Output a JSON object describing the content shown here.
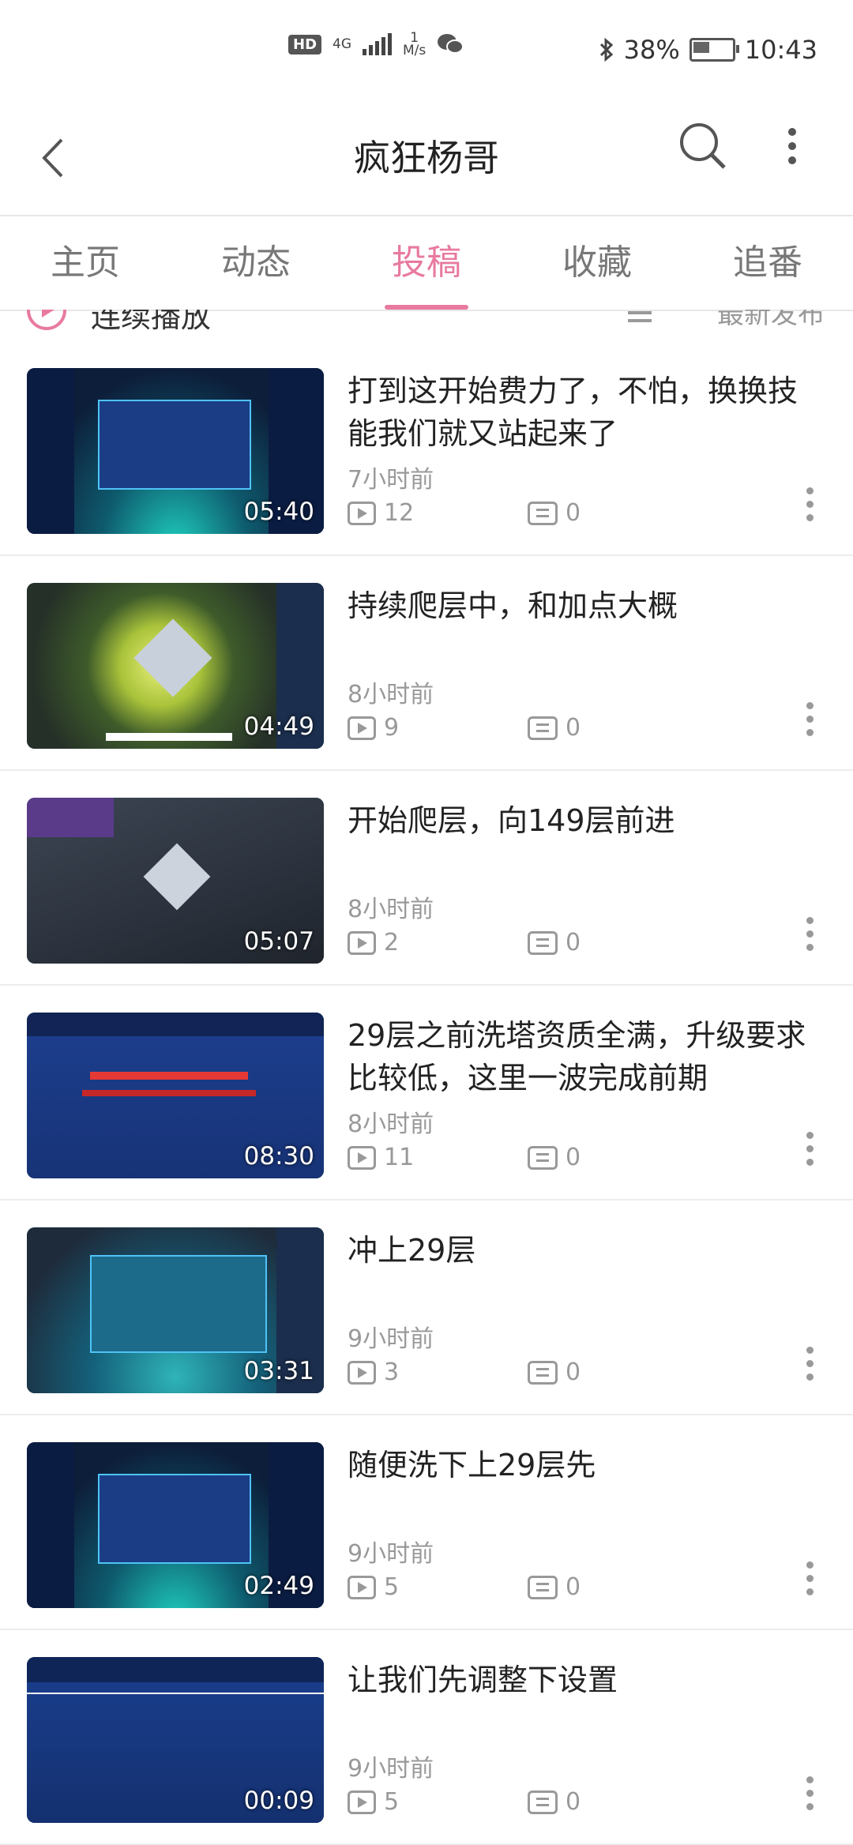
{
  "status": {
    "hd": "HD",
    "network": "4G",
    "speed_value": "1",
    "speed_unit": "M/s",
    "battery": "38%",
    "time": "10:43"
  },
  "header": {
    "title": "疯狂杨哥"
  },
  "tabs": [
    {
      "label": "主页"
    },
    {
      "label": "动态"
    },
    {
      "label": "投稿"
    },
    {
      "label": "收藏"
    },
    {
      "label": "追番"
    }
  ],
  "toolbar": {
    "autoplay_label": "连续播放",
    "sort_label": "最新发布"
  },
  "videos": [
    {
      "title": "打到这开始费力了，不怕，换换技能我们就又站起来了",
      "time": "7小时前",
      "views": "12",
      "comments": "0",
      "duration": "05:40"
    },
    {
      "title": "持续爬层中，和加点大概",
      "time": "8小时前",
      "views": "9",
      "comments": "0",
      "duration": "04:49"
    },
    {
      "title": "开始爬层，向149层前进",
      "time": "8小时前",
      "views": "2",
      "comments": "0",
      "duration": "05:07"
    },
    {
      "title": "29层之前洗塔资质全满，升级要求比较低，这里一波完成前期",
      "time": "8小时前",
      "views": "11",
      "comments": "0",
      "duration": "08:30"
    },
    {
      "title": "冲上29层",
      "time": "9小时前",
      "views": "3",
      "comments": "0",
      "duration": "03:31"
    },
    {
      "title": "随便洗下上29层先",
      "time": "9小时前",
      "views": "5",
      "comments": "0",
      "duration": "02:49"
    },
    {
      "title": "让我们先调整下设置",
      "time": "9小时前",
      "views": "5",
      "comments": "0",
      "duration": "00:09"
    }
  ],
  "colors": {
    "accent": "#e87aa0"
  }
}
